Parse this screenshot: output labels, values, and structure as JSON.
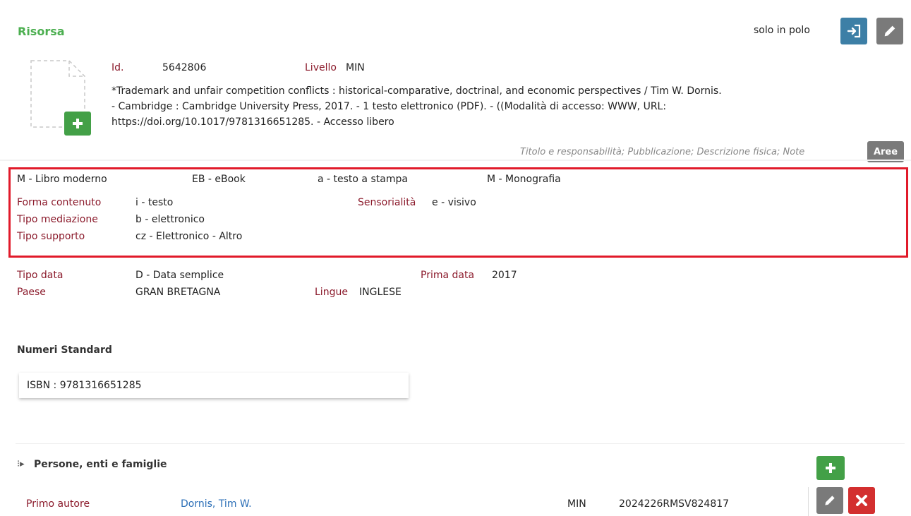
{
  "header": {
    "title": "Risorsa",
    "scope_label": "solo in polo"
  },
  "record": {
    "id_label": "Id.",
    "id_value": "5642806",
    "level_label": "Livello",
    "level_value": "MIN",
    "description_line1": "*Trademark and unfair competition conflicts : historical-comparative, doctrinal, and economic perspectives / Tim W. Dornis.",
    "description_line2": "- Cambridge : Cambridge University Press, 2017. - 1 testo elettronico (PDF). - ((Modalità di accesso: WWW, URL:",
    "description_line3": "https://doi.org/10.1017/9781316651285. - Accesso libero",
    "areas_text": "Titolo e responsabilità; Pubblicazione; Descrizione fisica; Note",
    "areas_button": "Aree"
  },
  "typology": {
    "material": "M - Libro moderno",
    "format": "EB - eBook",
    "record_type": "a - testo a stampa",
    "bib_level": "M - Monografia",
    "content_form_label": "Forma contenuto",
    "content_form_value": "i - testo",
    "sensory_label": "Sensorialità",
    "sensory_value": "e - visivo",
    "mediation_label": "Tipo mediazione",
    "mediation_value": "b - elettronico",
    "support_label": "Tipo supporto",
    "support_value": "cz - Elettronico - Altro"
  },
  "dates": {
    "date_type_label": "Tipo data",
    "date_type_value": "D - Data semplice",
    "first_date_label": "Prima data",
    "first_date_value": "2017",
    "country_label": "Paese",
    "country_value": "GRAN BRETAGNA",
    "languages_label": "Lingue",
    "languages_value": "INGLESE"
  },
  "standard_numbers": {
    "heading": "Numeri Standard",
    "isbn": "ISBN : 9781316651285"
  },
  "persons": {
    "heading": "Persone, enti e famiglie",
    "rows": [
      {
        "role": "Primo autore",
        "name": "Dornis, Tim W.",
        "level": "MIN",
        "vid": "2024226RMSV824817"
      }
    ]
  },
  "colors": {
    "title_green": "#4caf50",
    "label_red": "#8b1a2b",
    "highlight_border": "#e11a2a",
    "link_blue": "#2c6fb7"
  },
  "icons": [
    "export-icon",
    "pencil-icon",
    "plus-icon",
    "document-placeholder-icon",
    "close-icon",
    "tree-arrow-icon"
  ]
}
